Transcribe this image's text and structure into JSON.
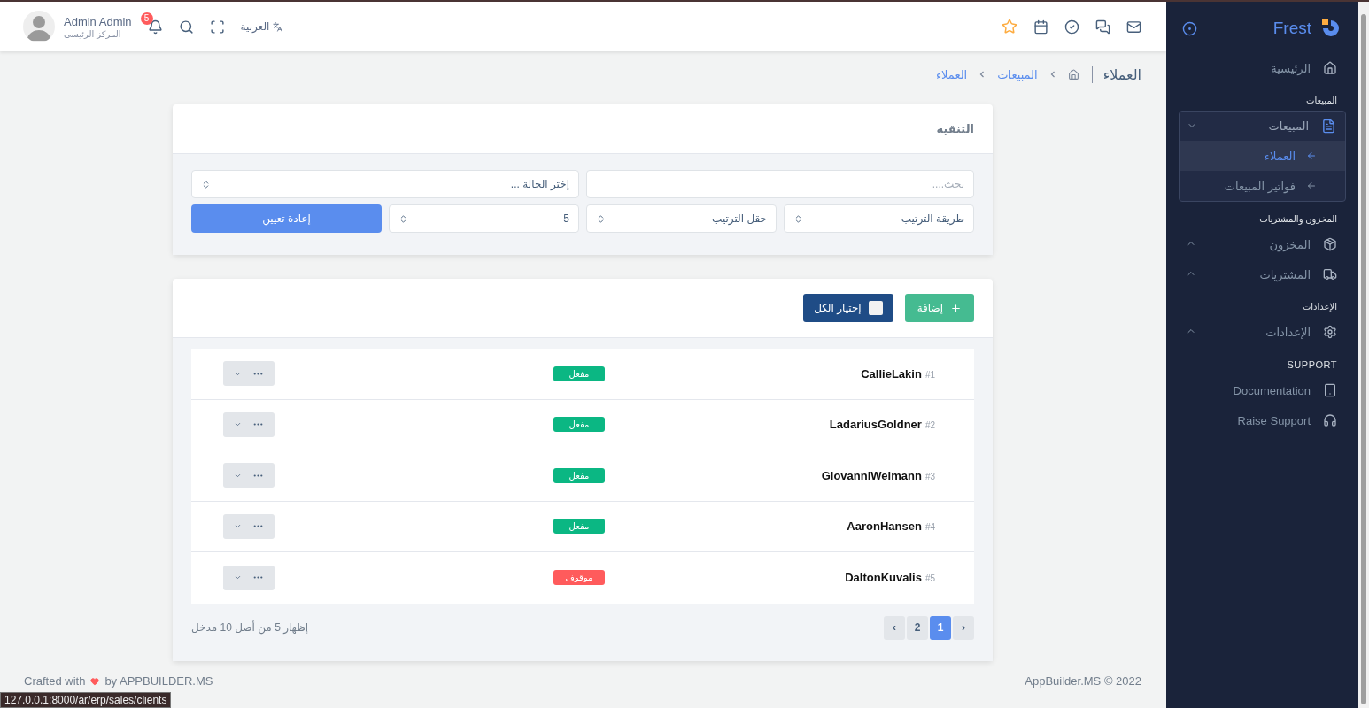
{
  "topbar": {
    "user": {
      "name": "Admin Admin",
      "role": "المركز الرئيسى"
    },
    "notifications": "5",
    "language": "العربية"
  },
  "breadcrumb": {
    "title": "العملاء",
    "links": [
      "المبيعات",
      "العملاء"
    ]
  },
  "filter": {
    "title": "التنقية",
    "search": {
      "placeholder": "بحث...."
    },
    "status": {
      "value": "إختر الحالة ..."
    },
    "sort_method": {
      "value": "طريقة الترتيب"
    },
    "sort_field": {
      "value": "حقل الترتيب"
    },
    "per_page": {
      "value": "5"
    },
    "reset": "إعادة تعيين"
  },
  "toolbar": {
    "add": "إضافة",
    "select_all": {
      "label": "إختيار الكل",
      "checked": false
    }
  },
  "clients": [
    {
      "name": "CallieLakin",
      "number": "#1",
      "status": "مفعل",
      "color": "#0bb783"
    },
    {
      "name": "LadariusGoldner",
      "number": "#2",
      "status": "مفعل",
      "color": "#0bb783"
    },
    {
      "name": "GiovanniWeimann",
      "number": "#3",
      "status": "مفعل",
      "color": "#0bb783"
    },
    {
      "name": "AaronHansen",
      "number": "#4",
      "status": "مفعل",
      "color": "#0bb783"
    },
    {
      "name": "DaltonKuvalis",
      "number": "#5",
      "status": "موقوف",
      "color": "#ff5b5c"
    }
  ],
  "pagination": {
    "info": "إظهار 5 من أصل 10 مدخل",
    "pages": [
      {
        "label": "›",
        "selected": false
      },
      {
        "label": "1",
        "selected": true
      },
      {
        "label": "2",
        "selected": false
      },
      {
        "label": "‹",
        "selected": false
      }
    ]
  },
  "footer": {
    "copyright": "AppBuilder.MS © 2022",
    "crafted_before": "Crafted with",
    "crafted_after": "by APPBUILDER.MS"
  },
  "status_url": "127.0.0.1:8000/ar/erp/sales/clients",
  "sidebar": {
    "brand": "Frest",
    "sections": [
      {
        "items": [
          {
            "label": "الرئيسية"
          }
        ]
      },
      {
        "header": "المبيعات",
        "items": [
          {
            "label": "المبيعات",
            "expanded": true,
            "children": [
              {
                "label": "العملاء",
                "selected": true
              },
              {
                "label": "فواتير المبيعات",
                "selected": false
              }
            ]
          }
        ]
      },
      {
        "header": "المخزون والمشتريات",
        "items": [
          {
            "label": "المخزون",
            "expanded": false
          },
          {
            "label": "المشتريات",
            "expanded": false
          }
        ]
      },
      {
        "header": "الإعدادات",
        "items": [
          {
            "label": "الإعدادات",
            "expanded": false
          }
        ]
      },
      {
        "header": "SUPPORT",
        "items": [
          {
            "label": "Documentation"
          },
          {
            "label": "Raise Support"
          }
        ]
      }
    ]
  }
}
